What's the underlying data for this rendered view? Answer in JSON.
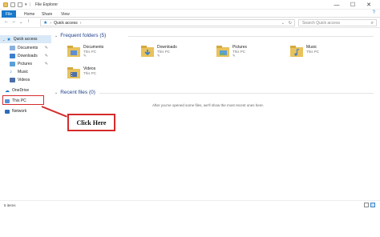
{
  "window": {
    "title": "File Explorer",
    "controls": [
      "—",
      "☐",
      "✕"
    ]
  },
  "ribbon": {
    "tabs": [
      "File",
      "Home",
      "Share",
      "View"
    ],
    "help": "?"
  },
  "address": {
    "path": [
      "Quick access"
    ],
    "search_placeholder": "Search Quick access"
  },
  "navpane": {
    "items": [
      {
        "label": "Quick access",
        "pinned": false
      },
      {
        "label": "Documents",
        "pinned": true
      },
      {
        "label": "Downloads",
        "pinned": true
      },
      {
        "label": "Pictures",
        "pinned": true
      },
      {
        "label": "Music",
        "pinned": false
      },
      {
        "label": "Videos",
        "pinned": false
      },
      {
        "label": "OneDrive",
        "pinned": false
      },
      {
        "label": "This PC",
        "pinned": false
      },
      {
        "label": "Network",
        "pinned": false
      }
    ]
  },
  "content": {
    "frequent_title": "Frequent folders (5)",
    "recent_title": "Recent files (0)",
    "empty_message": "After you've opened some files, we'll show the most recent ones here.",
    "folders": [
      {
        "name": "Documents",
        "location": "This PC",
        "color": "#5b8fd6"
      },
      {
        "name": "Downloads",
        "location": "This PC",
        "color": "#3a7fd0"
      },
      {
        "name": "Pictures",
        "location": "This PC",
        "color": "#5aa0d8"
      },
      {
        "name": "Music",
        "location": "This PC",
        "color": "#4a7fc7"
      },
      {
        "name": "Videos",
        "location": "This PC",
        "color": "#4c6fa8"
      }
    ]
  },
  "callout": {
    "text": "Click Here",
    "color": "#d52b2b"
  },
  "status": {
    "count": "5 items"
  },
  "colors": {
    "accent": "#1979ca",
    "folder": "#e8c25b",
    "selected": "#d9e9f7"
  }
}
